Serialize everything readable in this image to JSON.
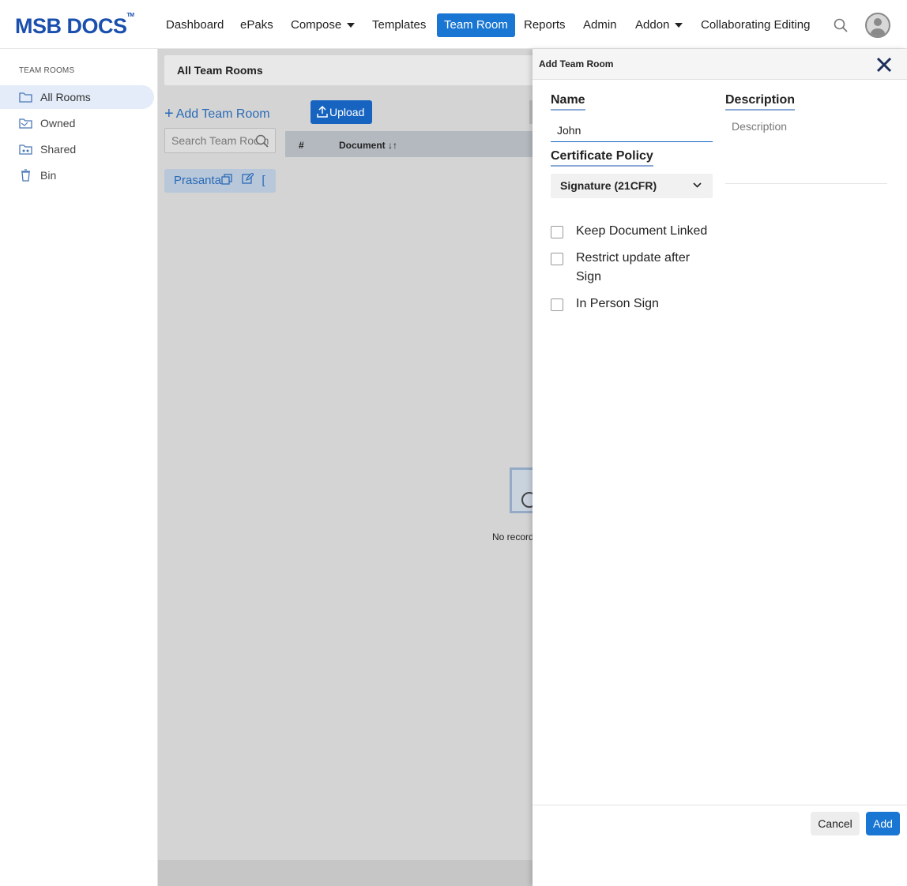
{
  "app": {
    "logo": "MSB DOCS",
    "logo_tm": "TM"
  },
  "nav": {
    "items": [
      {
        "label": "Dashboard"
      },
      {
        "label": "ePaks"
      },
      {
        "label": "Compose"
      },
      {
        "label": "Templates"
      },
      {
        "label": "Team Room",
        "active": true
      },
      {
        "label": "Reports"
      },
      {
        "label": "Admin"
      },
      {
        "label": "Addon"
      },
      {
        "label": "Collaborating Editing"
      }
    ],
    "search_icon": "search-icon",
    "avatar_icon": "user-avatar-icon"
  },
  "sidebar": {
    "heading": "TEAM ROOMS",
    "items": [
      {
        "label": "All Rooms",
        "icon": "folder-icon",
        "active": true
      },
      {
        "label": "Owned",
        "icon": "folder-open-icon"
      },
      {
        "label": "Shared",
        "icon": "shared-folder-icon"
      },
      {
        "label": "Bin",
        "icon": "trash-icon"
      }
    ]
  },
  "main": {
    "header_title": "All Team Rooms",
    "add_room_label": "Add Team Room",
    "upload_label": "Upload",
    "search_placeholder": "Search Team Room",
    "table": {
      "col_num": "#",
      "col_document": "Document"
    },
    "room_chip_label": "Prasanta",
    "room_chip_cut": "[",
    "empty_text": "No records"
  },
  "panel": {
    "title": "Add Team Room",
    "name_label": "Name",
    "name_value": "John",
    "description_label": "Description",
    "description_placeholder": "Description",
    "cert_policy_label": "Certificate Policy",
    "cert_policy_value": "Signature (21CFR)",
    "checkboxes": [
      {
        "label": "Keep Document Linked",
        "checked": false
      },
      {
        "label": "Restrict update after Sign",
        "checked": false
      },
      {
        "label": "In Person Sign",
        "checked": false
      }
    ],
    "cancel_label": "Cancel",
    "add_label": "Add"
  },
  "colors": {
    "brand": "#1a4fae",
    "accent": "#1976d2",
    "link": "#2a6bb7"
  }
}
